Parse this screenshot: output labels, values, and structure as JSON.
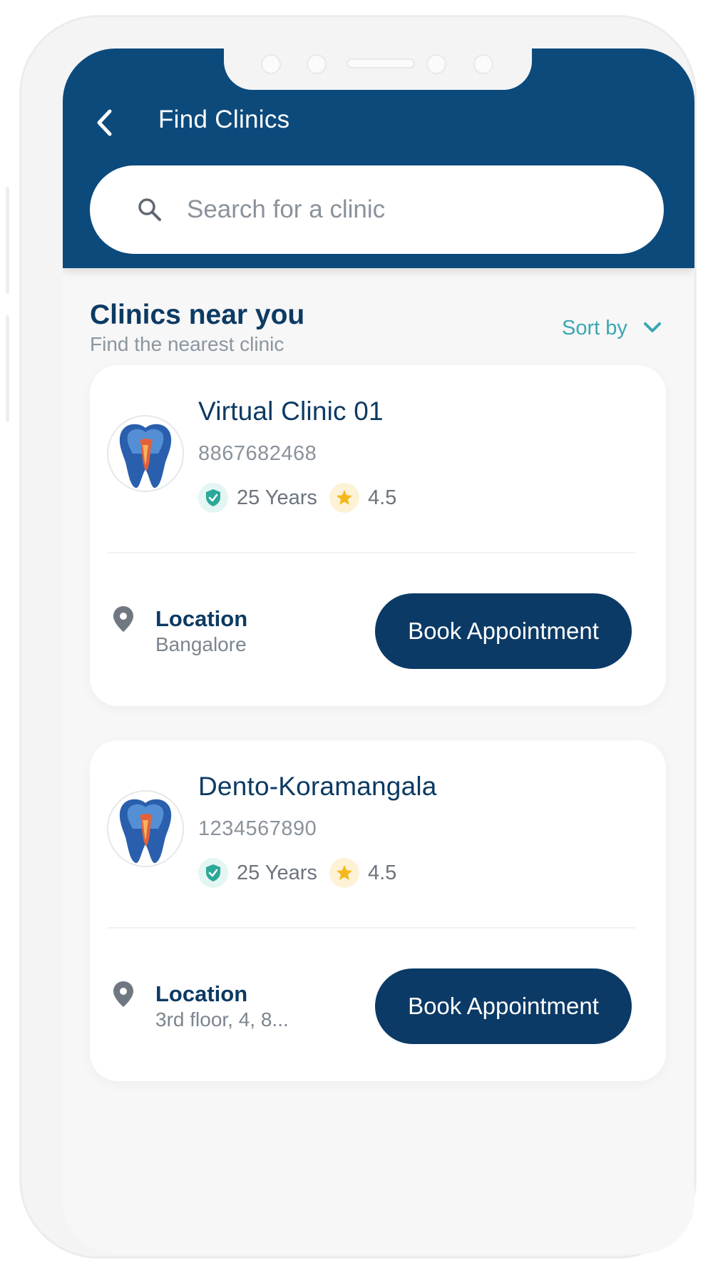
{
  "header": {
    "title": "Find Clinics",
    "back_icon": "chevron-left-icon",
    "background_color": "#0c4a7c"
  },
  "search": {
    "placeholder": "Search for a clinic",
    "value": "",
    "icon": "search-icon"
  },
  "section": {
    "title": "Clinics near you",
    "subtitle": "Find the nearest clinic",
    "sort_label": "Sort by",
    "sort_icon": "chevron-down-icon",
    "accent_color": "#3aa7b4"
  },
  "clinics": [
    {
      "name": "Virtual Clinic 01",
      "phone": "8867682468",
      "experience": "25 Years",
      "rating": "4.5",
      "location_label": "Location",
      "location": "Bangalore",
      "button_label": "Book Appointment"
    },
    {
      "name": "Dento-Koramangala",
      "phone": "1234567890",
      "experience": "25 Years",
      "rating": "4.5",
      "location_label": "Location",
      "location": "3rd floor, 4, 8...",
      "button_label": "Book Appointment"
    }
  ],
  "colors": {
    "primary_dark": "#0c3a66",
    "shield_green": "#2ba89a",
    "star_yellow": "#f5b81c"
  }
}
